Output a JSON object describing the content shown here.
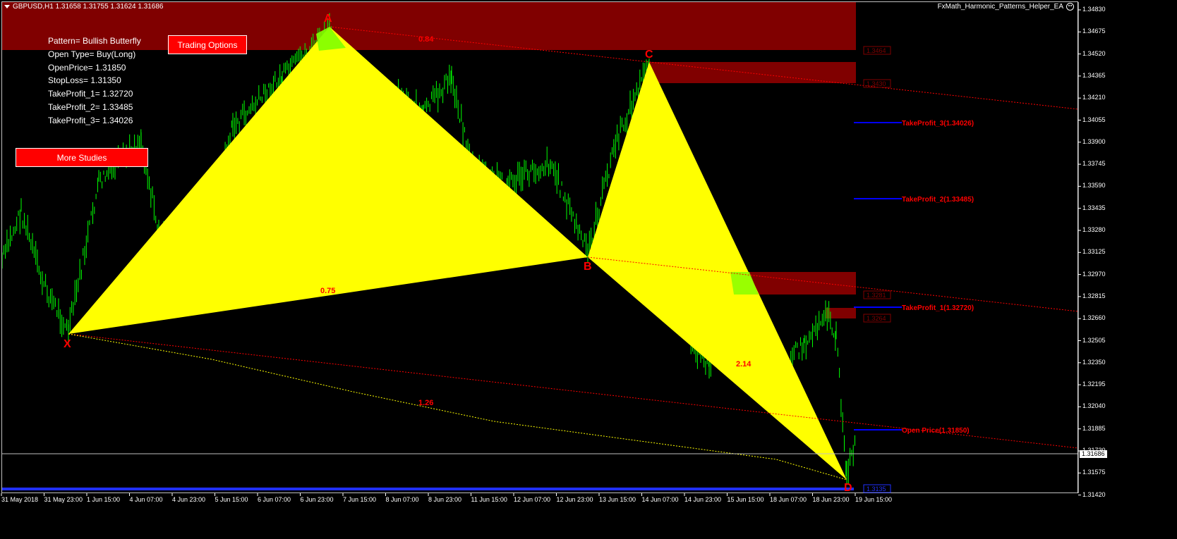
{
  "header": {
    "symbol_info": "GBPUSD,H1  1.31658 1.31755 1.31624 1.31686",
    "ea_name": "FxMath_Harmonic_Patterns_Helper_EA"
  },
  "info": {
    "pattern": "Pattern= Bullish Butterfly",
    "open_type": "Open Type= Buy(Long)",
    "open_price": "OpenPrice= 1.31850",
    "stop_loss": "StopLoss= 1.31350",
    "tp1": "TakeProfit_1= 1.32720",
    "tp2": "TakeProfit_2= 1.33485",
    "tp3": "TakeProfit_3= 1.34026"
  },
  "buttons": {
    "trading_options": "Trading Options",
    "more_studies": "More Studies"
  },
  "price_axis": [
    "1.34830",
    "1.34675",
    "1.34520",
    "1.34365",
    "1.34210",
    "1.34055",
    "1.33900",
    "1.33745",
    "1.33590",
    "1.33435",
    "1.33280",
    "1.33125",
    "1.32970",
    "1.32815",
    "1.32660",
    "1.32505",
    "1.32350",
    "1.32195",
    "1.32040",
    "1.31885",
    "1.31730",
    "1.31575",
    "1.31420"
  ],
  "current_price": "1.31686",
  "time_axis": [
    "31 May 2018",
    "31 May 23:00",
    "1 Jun 15:00",
    "4 Jun 07:00",
    "4 Jun 23:00",
    "5 Jun 15:00",
    "6 Jun 07:00",
    "6 Jun 23:00",
    "7 Jun 15:00",
    "8 Jun 07:00",
    "8 Jun 23:00",
    "11 Jun 15:00",
    "12 Jun 07:00",
    "12 Jun 23:00",
    "13 Jun 15:00",
    "14 Jun 07:00",
    "14 Jun 23:00",
    "15 Jun 15:00",
    "18 Jun 07:00",
    "18 Jun 23:00",
    "19 Jun 15:00"
  ],
  "pattern_points": {
    "x": "X",
    "a": "A",
    "b": "B",
    "c": "C",
    "d": "D"
  },
  "ratios": {
    "ab": "0.84",
    "xb": "0.75",
    "bd": "2.14",
    "xd": "1.26"
  },
  "zone_labels": [
    "1.3464",
    "1.3430",
    "1.3281",
    "1.3264",
    "1.3135"
  ],
  "levels": {
    "tp3": "TakeProfit_3(1.34026)",
    "tp2": "TakeProfit_2(1.33485)",
    "tp1": "TakeProfit_1(1.32720)",
    "open": "Open Price(1.31850)"
  },
  "colors": {
    "background": "#000000",
    "candles": "#00ff00",
    "pattern_fill": "#ffff00",
    "zone": "#800000",
    "level_line": "#0000ff",
    "label_red": "#ff0000"
  }
}
